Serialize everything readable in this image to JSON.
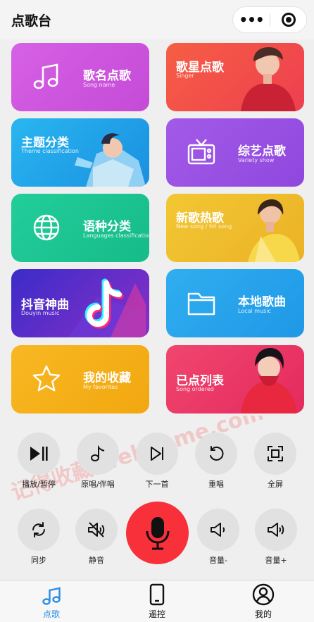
{
  "header": {
    "title": "点歌台",
    "more_icon": "more-dots-icon",
    "target_icon": "target-icon"
  },
  "cards": [
    {
      "id": "song-name",
      "zh": "歌名点歌",
      "en": "Song name",
      "icon": "music-note-icon",
      "color": "#d25be0"
    },
    {
      "id": "singer",
      "zh": "歌星点歌",
      "en": "Singer",
      "icon": "singer-photo",
      "color": "#f25345"
    },
    {
      "id": "theme",
      "zh": "主题分类",
      "en": "Theme classification",
      "icon": "theme-photo",
      "color": "#1e9fe6"
    },
    {
      "id": "variety",
      "zh": "综艺点歌",
      "en": "Variety show",
      "icon": "tv-icon",
      "color": "#9a52e6"
    },
    {
      "id": "language",
      "zh": "语种分类",
      "en": "Languages classification",
      "icon": "globe-icon",
      "color": "#24c997"
    },
    {
      "id": "new-hot",
      "zh": "新歌热歌",
      "en": "New song / hit song",
      "icon": "new-hot-photo",
      "color": "#f0bc2a"
    },
    {
      "id": "douyin",
      "zh": "抖音神曲",
      "en": "Douyin music",
      "icon": "tiktok-icon",
      "color": "#5a2fd6"
    },
    {
      "id": "local",
      "zh": "本地歌曲",
      "en": "Local music",
      "icon": "folder-icon",
      "color": "#2aa4ea"
    },
    {
      "id": "favorites",
      "zh": "我的收藏",
      "en": "My favorites",
      "icon": "star-icon",
      "color": "#f5b21a"
    },
    {
      "id": "ordered",
      "zh": "已点列表",
      "en": "Song ordered",
      "icon": "ordered-photo",
      "color": "#f04070"
    }
  ],
  "controls": [
    {
      "id": "play-pause",
      "label": "播放/暂停",
      "icon": "play-pause-icon"
    },
    {
      "id": "original-accompany",
      "label": "原唱/伴唱",
      "icon": "music-note-icon"
    },
    {
      "id": "next",
      "label": "下一首",
      "icon": "skip-next-icon"
    },
    {
      "id": "replay",
      "label": "重唱",
      "icon": "replay-icon"
    },
    {
      "id": "fullscreen",
      "label": "全屏",
      "icon": "fullscreen-icon"
    },
    {
      "id": "sync",
      "label": "同步",
      "icon": "sync-icon"
    },
    {
      "id": "mute",
      "label": "静音",
      "icon": "mute-icon"
    },
    {
      "id": "volume-down",
      "label": "音量-",
      "icon": "volume-down-icon"
    },
    {
      "id": "volume-up",
      "label": "音量+",
      "icon": "volume-up-icon"
    }
  ],
  "mic": {
    "icon": "microphone-icon",
    "color": "#f7303a"
  },
  "tabs": [
    {
      "id": "order-song",
      "label": "点歌",
      "icon": "music-notes-icon",
      "active": true
    },
    {
      "id": "remote",
      "label": "遥控",
      "icon": "phone-icon",
      "active": false
    },
    {
      "id": "mine",
      "label": "我的",
      "icon": "user-icon",
      "active": false
    }
  ],
  "watermark": {
    "text": "记得收藏 webhome.com"
  },
  "colors": {
    "accent": "#2a8de8",
    "mic": "#f7303a"
  }
}
